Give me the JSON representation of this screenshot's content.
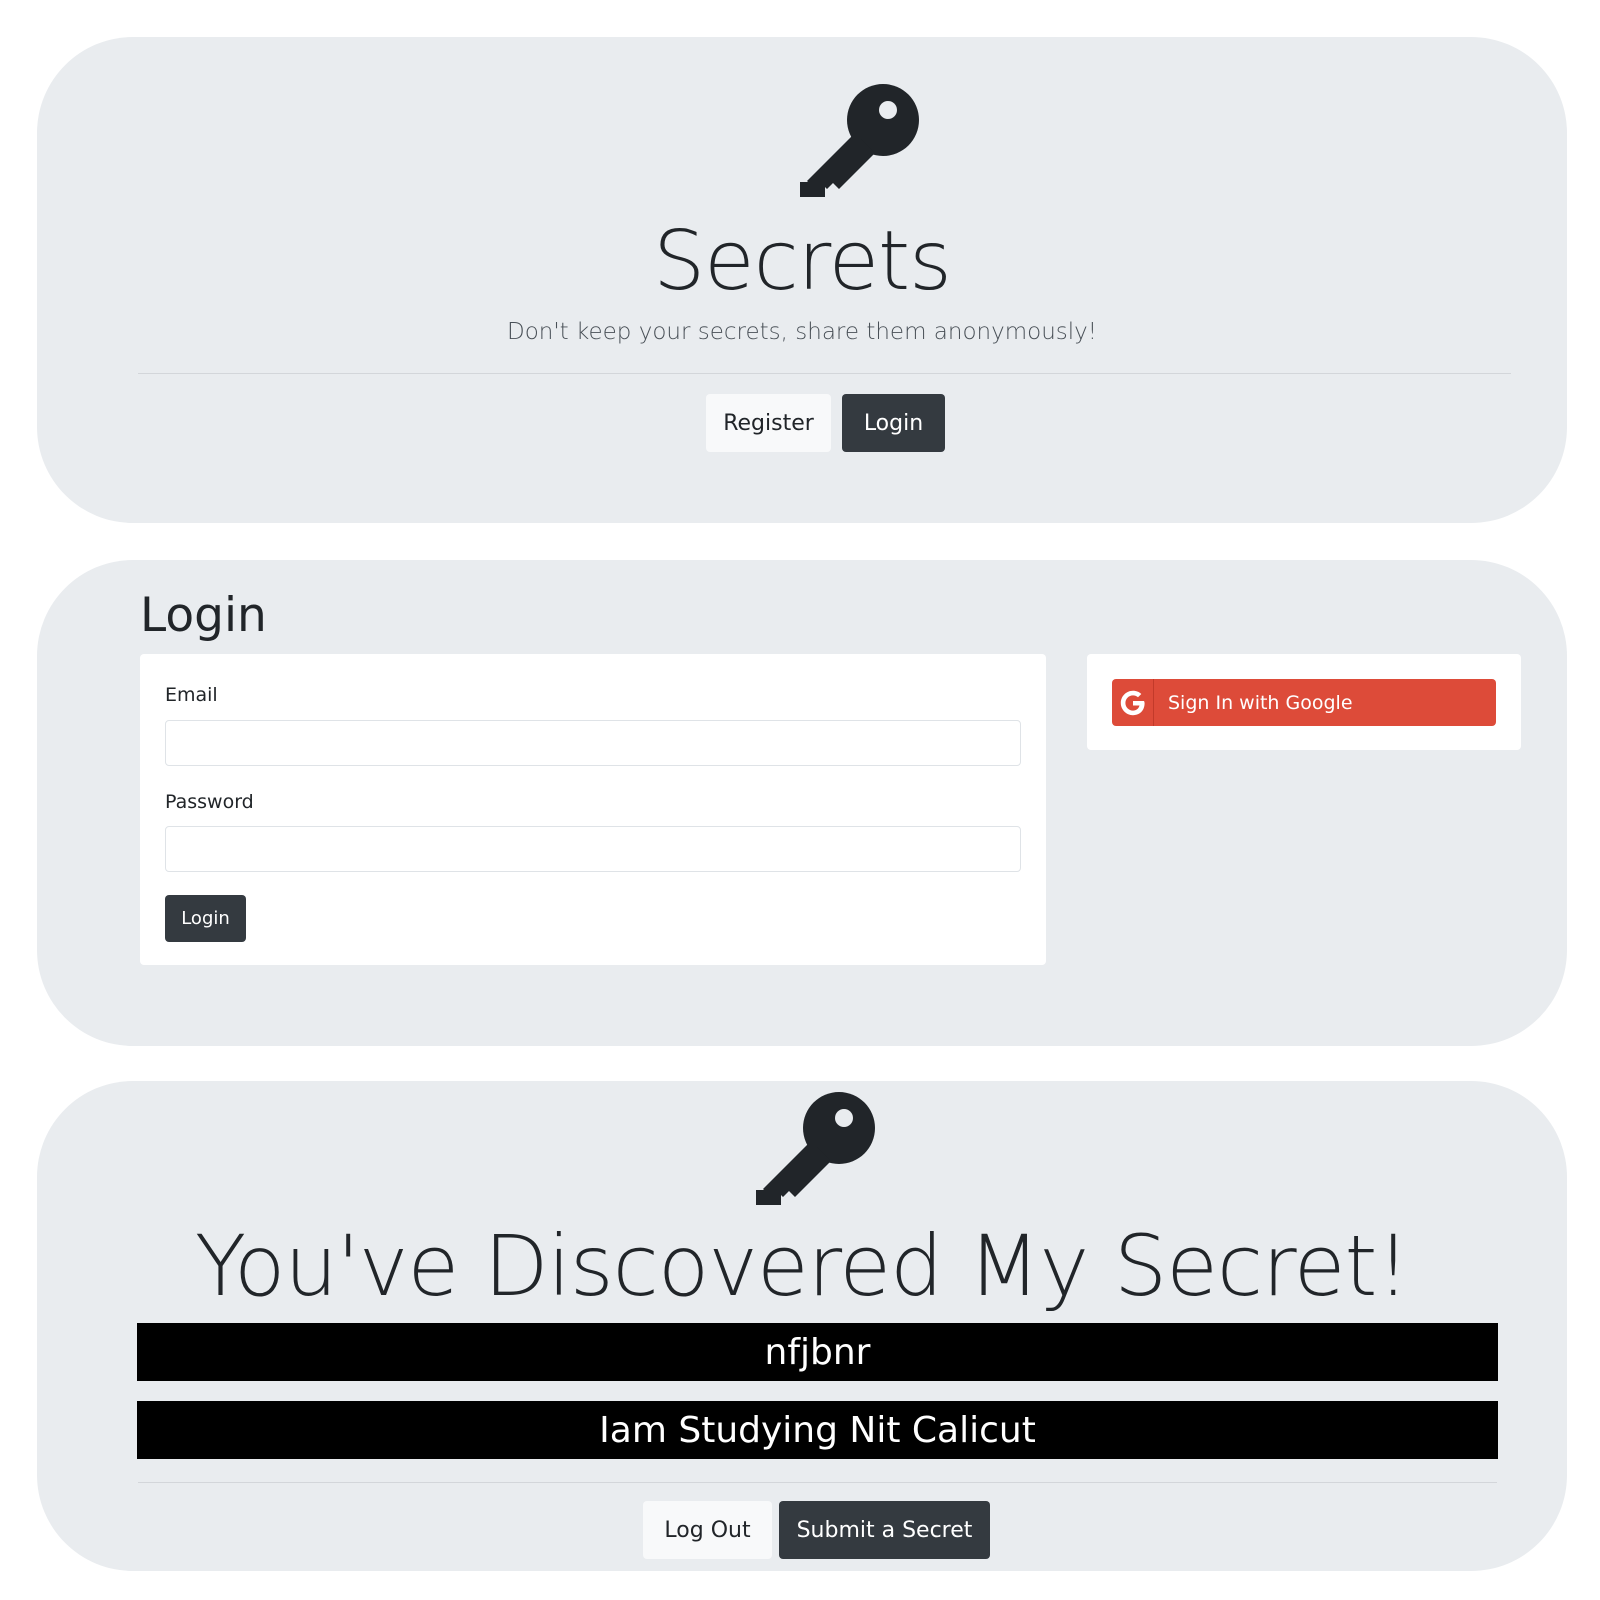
{
  "home": {
    "icon": "key-icon",
    "title": "Secrets",
    "lead": "Don't keep your secrets, share them anonymously!",
    "register_label": "Register",
    "login_label": "Login"
  },
  "login_page": {
    "heading": "Login",
    "email_label": "Email",
    "email_value": "",
    "password_label": "Password",
    "password_value": "",
    "submit_label": "Login",
    "google_label": "Sign In with Google",
    "google_icon": "google-icon",
    "google_color": "#dd4b39"
  },
  "secrets_page": {
    "icon": "key-icon",
    "title": "You've Discovered My Secret!",
    "secrets": [
      {
        "text": "nfjbnr"
      },
      {
        "text": "Iam Studying Nit Calicut"
      }
    ],
    "logout_label": "Log Out",
    "submit_label": "Submit a Secret"
  },
  "colors": {
    "panel_bg": "#e9ecef",
    "dark_button": "#343a40",
    "light_button": "#f8f9fa",
    "secret_bar": "#000000"
  }
}
